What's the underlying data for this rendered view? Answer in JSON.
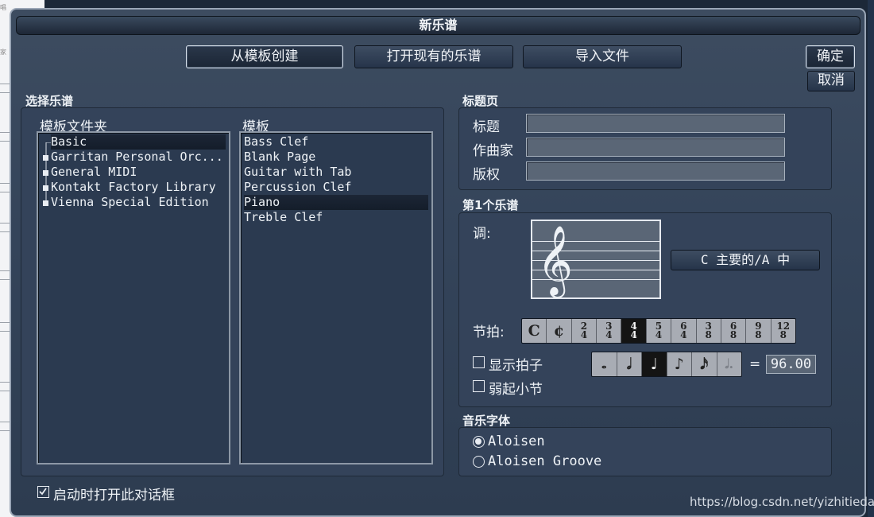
{
  "window": {
    "title": "新乐谱"
  },
  "tabs": [
    {
      "label": "从模板创建",
      "selected": true
    },
    {
      "label": "打开现有的乐谱",
      "selected": false
    },
    {
      "label": "导入文件",
      "selected": false
    }
  ],
  "actions": {
    "ok_label": "确定",
    "cancel_label": "取消"
  },
  "select_score": {
    "heading": "选择乐谱",
    "folder_label": "模板文件夹",
    "folders": [
      "Basic",
      "Garritan Personal Orc...",
      "General MIDI",
      "Kontakt Factory Library",
      "Vienna Special Edition"
    ],
    "selected_folder": "Basic",
    "template_label": "模板",
    "templates": [
      "Bass Clef",
      "Blank Page",
      "Guitar with Tab",
      "Percussion Clef",
      "Piano",
      "Treble Clef"
    ],
    "selected_template": "Piano"
  },
  "title_page": {
    "heading": "标题页",
    "title_label": "标题",
    "title_value": "",
    "composer_label": "作曲家",
    "composer_value": "",
    "copyright_label": "版权",
    "copyright_value": ""
  },
  "first_score": {
    "heading": "第1个乐谱",
    "key_label": "调:",
    "key_value": "C 主要的/A 中",
    "clef_icon": "treble-clef-icon",
    "time_label": "节拍:",
    "time_signatures": [
      "C",
      "¢",
      "2/4",
      "3/4",
      "4/4",
      "5/4",
      "6/4",
      "3/8",
      "6/8",
      "9/8",
      "12/8"
    ],
    "selected_time": "4/4",
    "show_tempo_label": "显示拍子",
    "show_tempo_checked": false,
    "note_values": [
      "whole",
      "half",
      "quarter",
      "eighth",
      "sixteenth",
      "dotted-half"
    ],
    "selected_note": "quarter",
    "tempo_equals": "=",
    "tempo_value": "96.00",
    "pickup_label": "弱起小节",
    "pickup_checked": false
  },
  "music_font": {
    "heading": "音乐字体",
    "options": [
      "Aloisen",
      "Aloisen Groove"
    ],
    "selected": "Aloisen"
  },
  "startup": {
    "label": "启动时打开此对话框",
    "checked": true
  },
  "watermark": "https://blog.csdn.net/yizhitiedan",
  "background": {
    "left_fragment_1": "唱",
    "left_fragment_2": "家"
  },
  "colors": {
    "dialog_bg": "#34445a",
    "title_bar": "#1d2736",
    "selected_row": "#141d2a",
    "field_bg": "#5a6676"
  }
}
